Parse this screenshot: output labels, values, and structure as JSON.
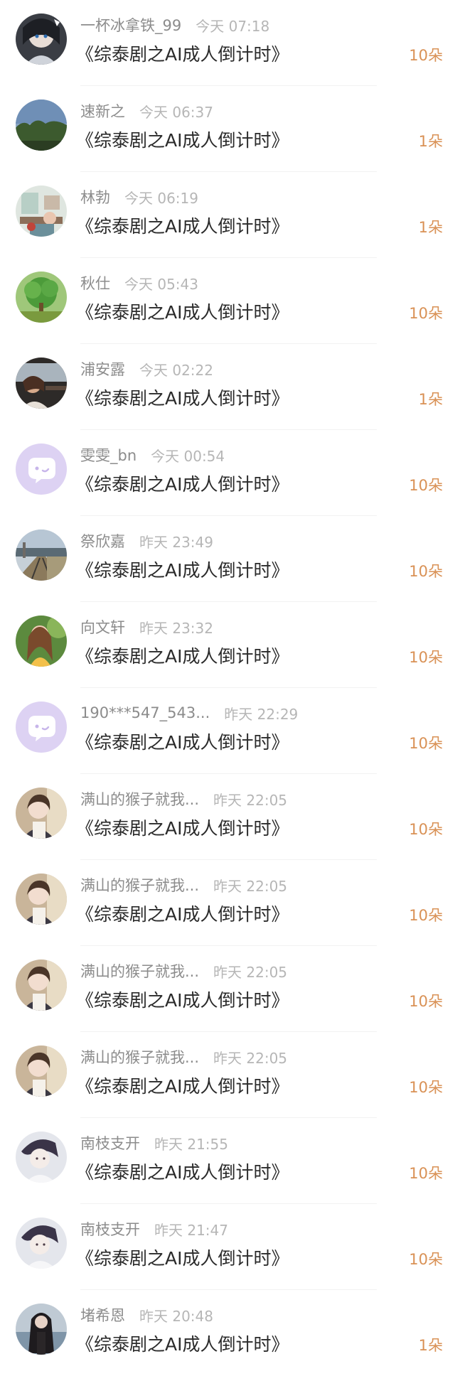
{
  "accent_color": "#d99155",
  "items": [
    {
      "name": "一杯冰拿铁_99",
      "time": "今天 07:18",
      "title": "《综泰剧之AI成人倒计时》",
      "gift": "10朵",
      "avatar": "anime-girl-dark-avatar"
    },
    {
      "name": "速新之",
      "time": "今天 06:37",
      "title": "《综泰剧之AI成人倒计时》",
      "gift": "1朵",
      "avatar": "sky-trees-avatar"
    },
    {
      "name": "林勃",
      "time": "今天 06:19",
      "title": "《综泰剧之AI成人倒计时》",
      "gift": "1朵",
      "avatar": "room-illustration-avatar"
    },
    {
      "name": "秋仕",
      "time": "今天 05:43",
      "title": "《综泰剧之AI成人倒计时》",
      "gift": "10朵",
      "avatar": "green-tree-avatar"
    },
    {
      "name": "浦安露",
      "time": "今天 02:22",
      "title": "《综泰剧之AI成人倒计时》",
      "gift": "1朵",
      "avatar": "car-portrait-avatar"
    },
    {
      "name": "雯雯_bn",
      "time": "今天 00:54",
      "title": "《综泰剧之AI成人倒计时》",
      "gift": "10朵",
      "avatar": "default-chat-avatar"
    },
    {
      "name": "祭欣嘉",
      "time": "昨天 23:49",
      "title": "《综泰剧之AI成人倒计时》",
      "gift": "10朵",
      "avatar": "railway-avatar"
    },
    {
      "name": "向文轩",
      "time": "昨天 23:32",
      "title": "《综泰剧之AI成人倒计时》",
      "gift": "10朵",
      "avatar": "girl-nature-avatar"
    },
    {
      "name": "190***547_543...",
      "time": "昨天 22:29",
      "title": "《综泰剧之AI成人倒计时》",
      "gift": "10朵",
      "avatar": "default-chat-avatar"
    },
    {
      "name": "满山的猴子就我...",
      "time": "昨天 22:05",
      "title": "《综泰剧之AI成人倒计时》",
      "gift": "10朵",
      "avatar": "anime-boy-avatar"
    },
    {
      "name": "满山的猴子就我...",
      "time": "昨天 22:05",
      "title": "《综泰剧之AI成人倒计时》",
      "gift": "10朵",
      "avatar": "anime-boy-avatar"
    },
    {
      "name": "满山的猴子就我...",
      "time": "昨天 22:05",
      "title": "《综泰剧之AI成人倒计时》",
      "gift": "10朵",
      "avatar": "anime-boy-avatar"
    },
    {
      "name": "满山的猴子就我...",
      "time": "昨天 22:05",
      "title": "《综泰剧之AI成人倒计时》",
      "gift": "10朵",
      "avatar": "anime-boy-avatar"
    },
    {
      "name": "南枝支开",
      "time": "昨天 21:55",
      "title": "《综泰剧之AI成人倒计时》",
      "gift": "10朵",
      "avatar": "pale-portrait-avatar"
    },
    {
      "name": "南枝支开",
      "time": "昨天 21:47",
      "title": "《综泰剧之AI成人倒计时》",
      "gift": "10朵",
      "avatar": "pale-portrait-avatar"
    },
    {
      "name": "堵希恩",
      "time": "昨天 20:48",
      "title": "《综泰剧之AI成人倒计时》",
      "gift": "1朵",
      "avatar": "dark-hair-girl-avatar"
    }
  ]
}
